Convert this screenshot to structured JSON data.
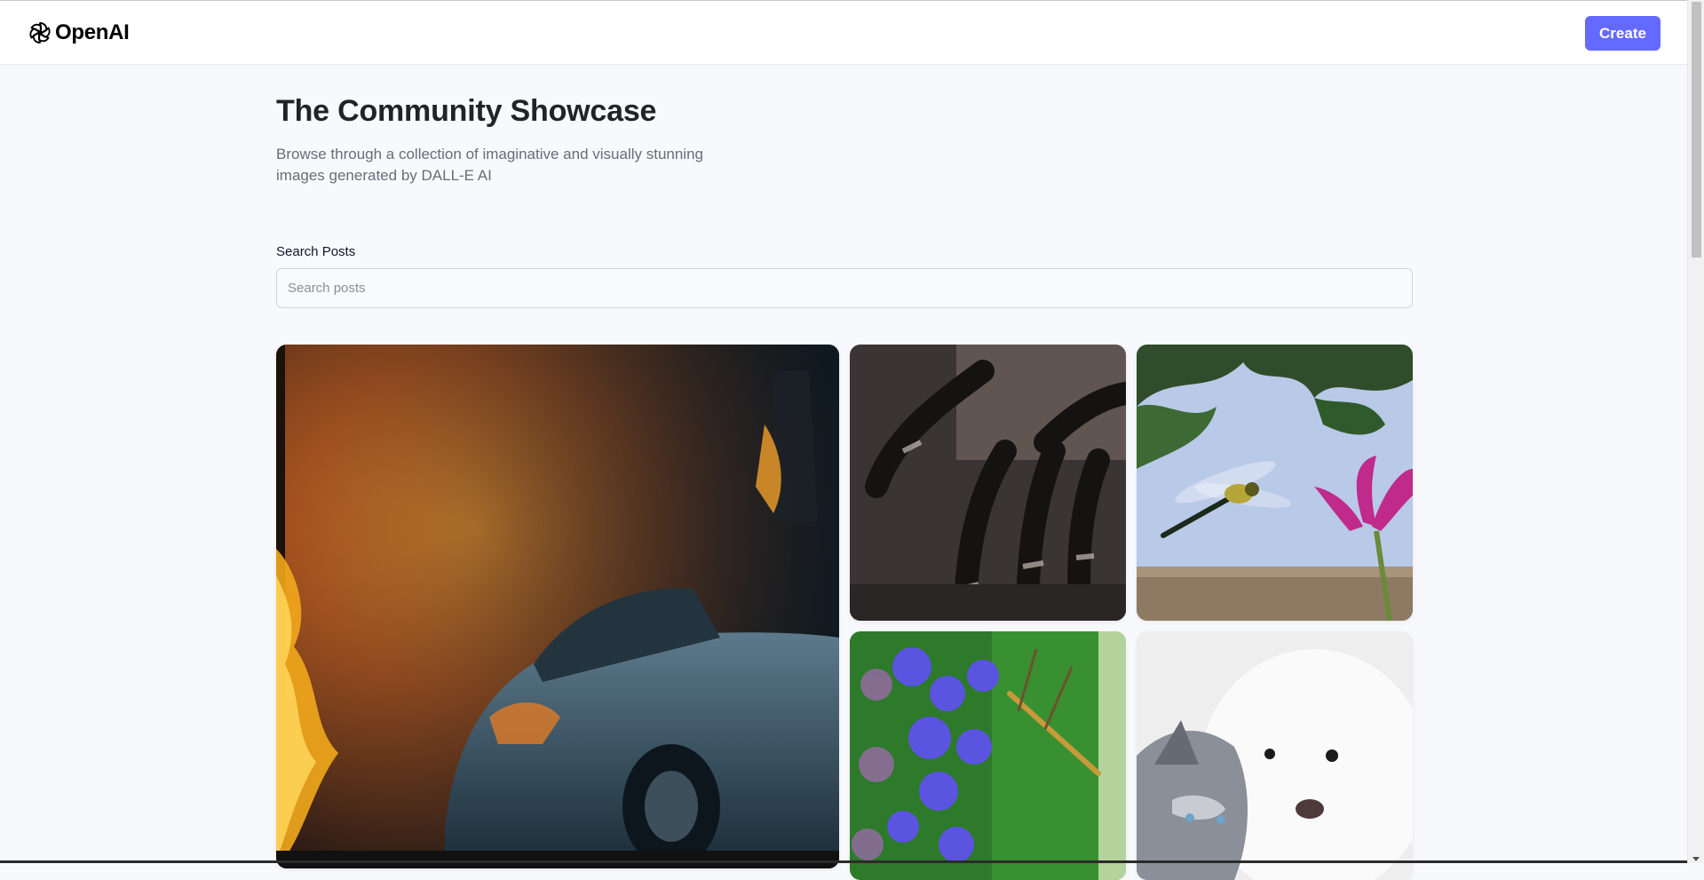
{
  "header": {
    "logo_text": "OpenAI",
    "create_label": "Create"
  },
  "hero": {
    "title": "The Community Showcase",
    "subtitle": "Browse through a collection of imaginative and visually stunning images generated by DALL-E AI"
  },
  "search": {
    "label": "Search Posts",
    "placeholder": "Search posts",
    "value": ""
  },
  "gallery": {
    "items": [
      {
        "subject": "burning car"
      },
      {
        "subject": "tarantula"
      },
      {
        "subject": "dragonfly"
      },
      {
        "subject": "purple flowers"
      },
      {
        "subject": "cat and dog"
      }
    ]
  },
  "colors": {
    "accent": "#6469ff",
    "background": "#f8f9fd",
    "title": "#222328",
    "subtitle": "#666e75"
  }
}
